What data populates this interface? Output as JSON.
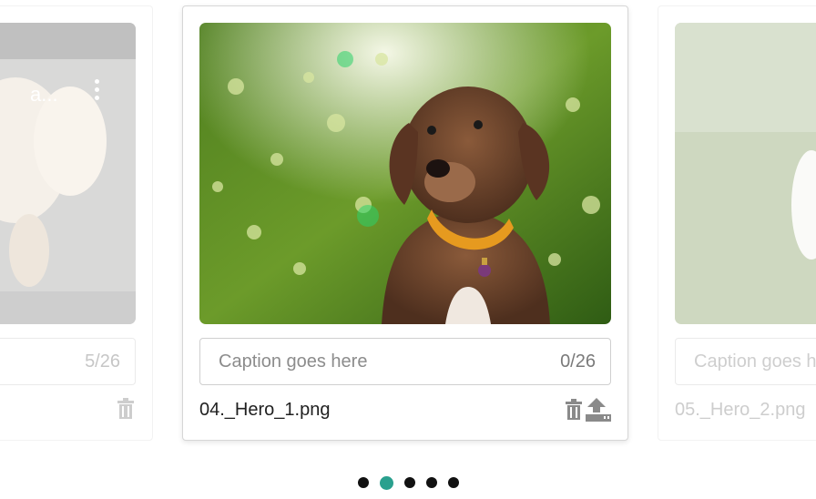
{
  "slides": {
    "left": {
      "caption_count": "5/26",
      "overlay_title": "a...",
      "filename": ""
    },
    "center": {
      "caption_placeholder": "Caption goes here",
      "caption_count": "0/26",
      "filename": "04._Hero_1.png"
    },
    "right": {
      "caption_placeholder": "Caption goes here",
      "filename": "05._Hero_2.png"
    }
  },
  "icons": {
    "delete": "trash-icon",
    "replace": "upload-icon",
    "menu": "kebab-menu-icon"
  },
  "pagination": {
    "count": 5,
    "active_index": 1
  },
  "colors": {
    "accent": "#2aa08e",
    "dot": "#111111",
    "border": "#cfcfcf"
  }
}
